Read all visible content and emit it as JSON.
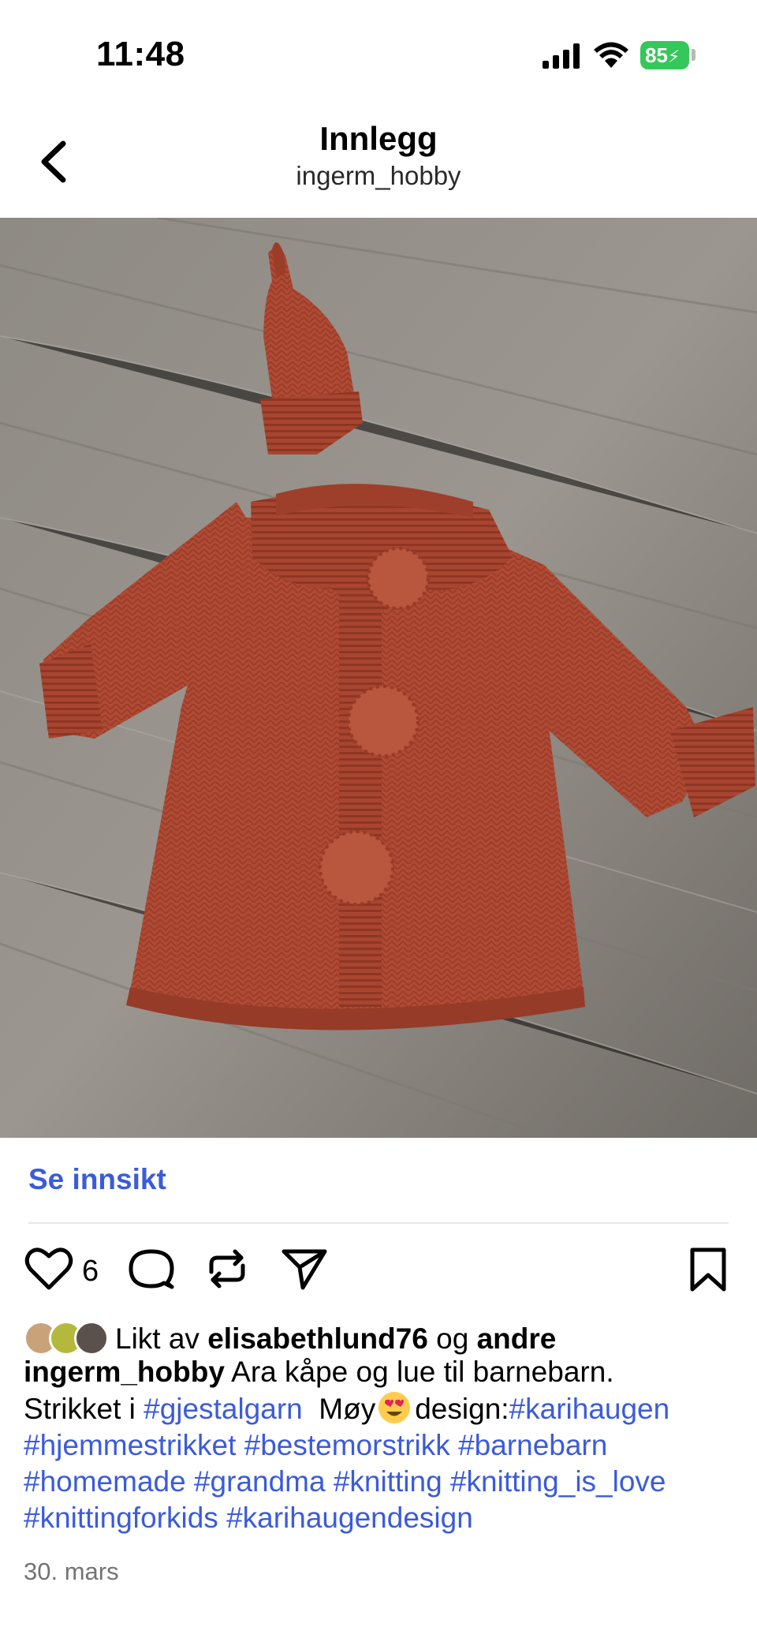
{
  "status_bar": {
    "time": "11:48",
    "battery": "85"
  },
  "header": {
    "title": "Innlegg",
    "username": "ingerm_hobby"
  },
  "insights": {
    "label": "Se innsikt"
  },
  "actions": {
    "like_count": "6"
  },
  "likes": {
    "prefix": "Likt av",
    "user": "elisabethlund76",
    "joiner": "og",
    "others": "andre"
  },
  "caption": {
    "username": "ingerm_hobby",
    "text1": "Ara kåpe og lue til barnebarn.",
    "text2_prefix": "Strikket i",
    "tag_gjestal": "#gjestalgarn",
    "text2_moy": "Møy",
    "text2_design": "design:",
    "tag_karihaugen": "#karihaugen",
    "tags_line3": [
      "#hjemmestrikket",
      "#bestemorstrikk",
      "#barnebarn"
    ],
    "tags_line4": [
      "#homemade",
      "#grandma",
      "#knitting",
      "#knitting_is_love"
    ],
    "tags_line5": [
      "#knittingforkids",
      "#karihaugendesign"
    ]
  },
  "date": "30. mars",
  "colors": {
    "link": "#3b5bdb",
    "battery": "#34c759",
    "coat": "#b24a33",
    "floor": "#8c8780"
  },
  "icons": [
    "signal-icon",
    "wifi-icon",
    "battery-icon",
    "back-chevron-icon",
    "heart-icon",
    "comment-icon",
    "repost-icon",
    "send-icon",
    "bookmark-icon",
    "heart-eyes-emoji-icon"
  ]
}
